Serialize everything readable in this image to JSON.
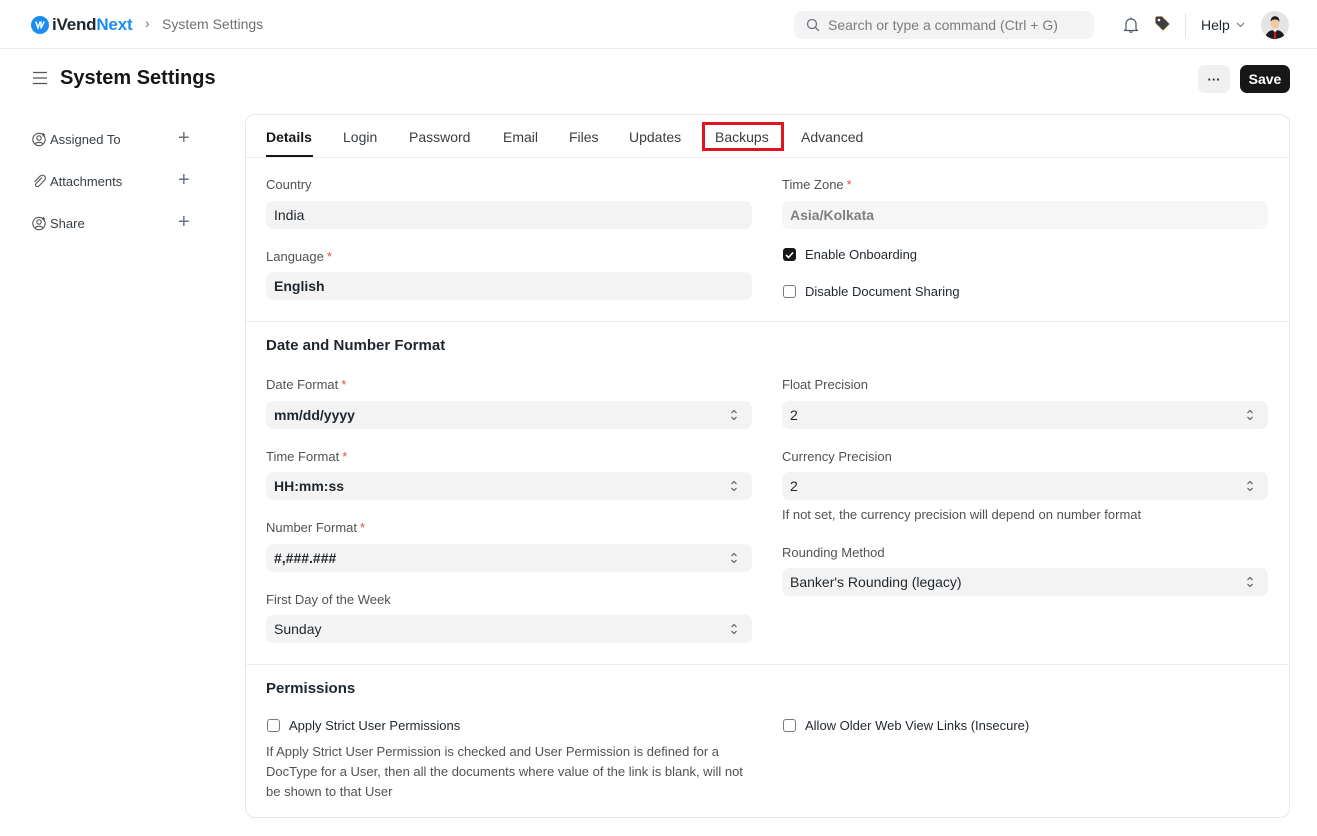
{
  "navbar": {
    "brand_prefix": "iVend",
    "brand_suffix": "Next",
    "brand_logo_glyph": "iV",
    "breadcrumb_separator": "›",
    "breadcrumb": "System Settings",
    "search_placeholder": "Search or type a command (Ctrl + G)",
    "search_value": "",
    "help_label": "Help",
    "icons": [
      "bell-icon",
      "tag-icon",
      "avatar"
    ]
  },
  "page": {
    "title": "System Settings",
    "more_label": "···",
    "save_label": "Save"
  },
  "sidebar": {
    "items": [
      {
        "label": "Assigned To",
        "icon": "user-add-icon",
        "action": "+"
      },
      {
        "label": "Attachments",
        "icon": "paperclip-icon",
        "action": "+"
      },
      {
        "label": "Share",
        "icon": "user-add-icon",
        "action": "+"
      }
    ]
  },
  "tabs": [
    {
      "label": "Details",
      "active": true
    },
    {
      "label": "Login",
      "active": false
    },
    {
      "label": "Password",
      "active": false
    },
    {
      "label": "Email",
      "active": false
    },
    {
      "label": "Files",
      "active": false
    },
    {
      "label": "Updates",
      "active": false
    },
    {
      "label": "Backups",
      "active": false,
      "highlighted": true
    },
    {
      "label": "Advanced",
      "active": false
    }
  ],
  "highlight_color": "#e0131e",
  "general": {
    "country": {
      "label": "Country",
      "value": "India",
      "required": false
    },
    "language": {
      "label": "Language",
      "value": "English",
      "required": true
    },
    "time_zone": {
      "label": "Time Zone",
      "value": "Asia/Kolkata",
      "required": true
    },
    "enable_onboarding": {
      "label": "Enable Onboarding",
      "checked": true
    },
    "disable_document_sharing": {
      "label": "Disable Document Sharing",
      "checked": false
    }
  },
  "date_number": {
    "title": "Date and Number Format",
    "date_format": {
      "label": "Date Format",
      "value": "mm/dd/yyyy",
      "required": true
    },
    "time_format": {
      "label": "Time Format",
      "value": "HH:mm:ss",
      "required": true
    },
    "number_format": {
      "label": "Number Format",
      "value": "#,###.###",
      "required": true
    },
    "first_day": {
      "label": "First Day of the Week",
      "value": "Sunday",
      "required": false
    },
    "float_precision": {
      "label": "Float Precision",
      "value": "2"
    },
    "currency_precision": {
      "label": "Currency Precision",
      "value": "2",
      "help": "If not set, the currency precision will depend on number format"
    },
    "rounding_method": {
      "label": "Rounding Method",
      "value": "Banker's Rounding (legacy)"
    }
  },
  "permissions": {
    "title": "Permissions",
    "strict_user_permissions": {
      "label": "Apply Strict User Permissions",
      "checked": false,
      "help": "If Apply Strict User Permission is checked and User Permission is defined for a DocType for a User, then all the documents where value of the link is blank, will not be shown to that User"
    },
    "older_web_view_links": {
      "label": "Allow Older Web View Links (Insecure)",
      "checked": false
    }
  },
  "required_marker": "*"
}
